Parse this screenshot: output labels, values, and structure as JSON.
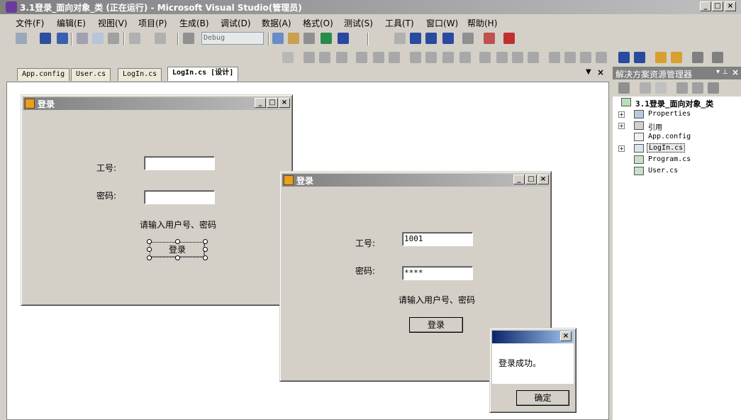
{
  "window": {
    "title": "3.1登录_面向对象_类 (正在运行) - Microsoft Visual Studio(管理员)",
    "min": "_",
    "max": "□",
    "close": "×"
  },
  "menu": [
    "文件(F)",
    "编辑(E)",
    "视图(V)",
    "项目(P)",
    "生成(B)",
    "调试(D)",
    "数据(A)",
    "格式(O)",
    "测试(S)",
    "工具(T)",
    "窗口(W)",
    "帮助(H)"
  ],
  "toolbar": {
    "config": "Debug"
  },
  "tabs": [
    {
      "label": "App.config"
    },
    {
      "label": "User.cs"
    },
    {
      "label": "LogIn.cs"
    },
    {
      "label": "LogIn.cs [设计]"
    }
  ],
  "designer": {
    "form_title": "登录",
    "id_label": "工号:",
    "pw_label": "密码:",
    "hint": "请输入用户号、密码",
    "login_button": "登录"
  },
  "running": {
    "form_title": "登录",
    "id_label": "工号:",
    "pw_label": "密码:",
    "id_value": "1001",
    "pw_value": "****",
    "hint": "请输入用户号、密码",
    "login_button": "登录"
  },
  "msgbox": {
    "message": "登录成功。",
    "ok": "确定",
    "close": "×"
  },
  "solution_explorer": {
    "title": "解决方案资源管理器",
    "project": "3.1登录_面向对象_类",
    "items": [
      "Properties",
      "引用",
      "App.config",
      "LogIn.cs",
      "Program.cs",
      "User.cs"
    ]
  }
}
